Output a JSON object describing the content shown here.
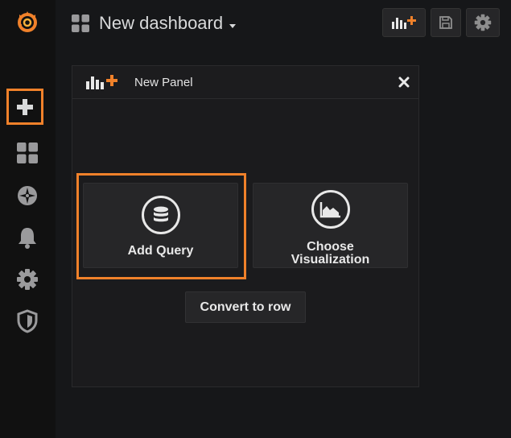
{
  "sidebar": {
    "items": [
      {
        "name": "grafana-logo",
        "icon": "grafana-logo-icon"
      },
      {
        "name": "create",
        "icon": "plus-icon",
        "highlighted": true
      },
      {
        "name": "dashboards",
        "icon": "grid-icon"
      },
      {
        "name": "explore",
        "icon": "compass-icon"
      },
      {
        "name": "alerting",
        "icon": "bell-icon"
      },
      {
        "name": "configuration",
        "icon": "gear-icon"
      },
      {
        "name": "server-admin",
        "icon": "shield-icon"
      }
    ]
  },
  "topbar": {
    "title": "New dashboard",
    "buttons": [
      {
        "name": "add-panel",
        "icon": "add-panel-icon"
      },
      {
        "name": "save",
        "icon": "save-icon"
      },
      {
        "name": "settings",
        "icon": "gear-icon"
      }
    ]
  },
  "panel": {
    "title": "New Panel",
    "actions": {
      "add_query": "Add Query",
      "choose_viz_line1": "Choose",
      "choose_viz_line2": "Visualization",
      "convert_row": "Convert to row"
    }
  },
  "colors": {
    "accent": "#f0812a",
    "background": "#161719",
    "sidebar": "#111111",
    "card": "#262628",
    "text": "#e8e8e8"
  }
}
